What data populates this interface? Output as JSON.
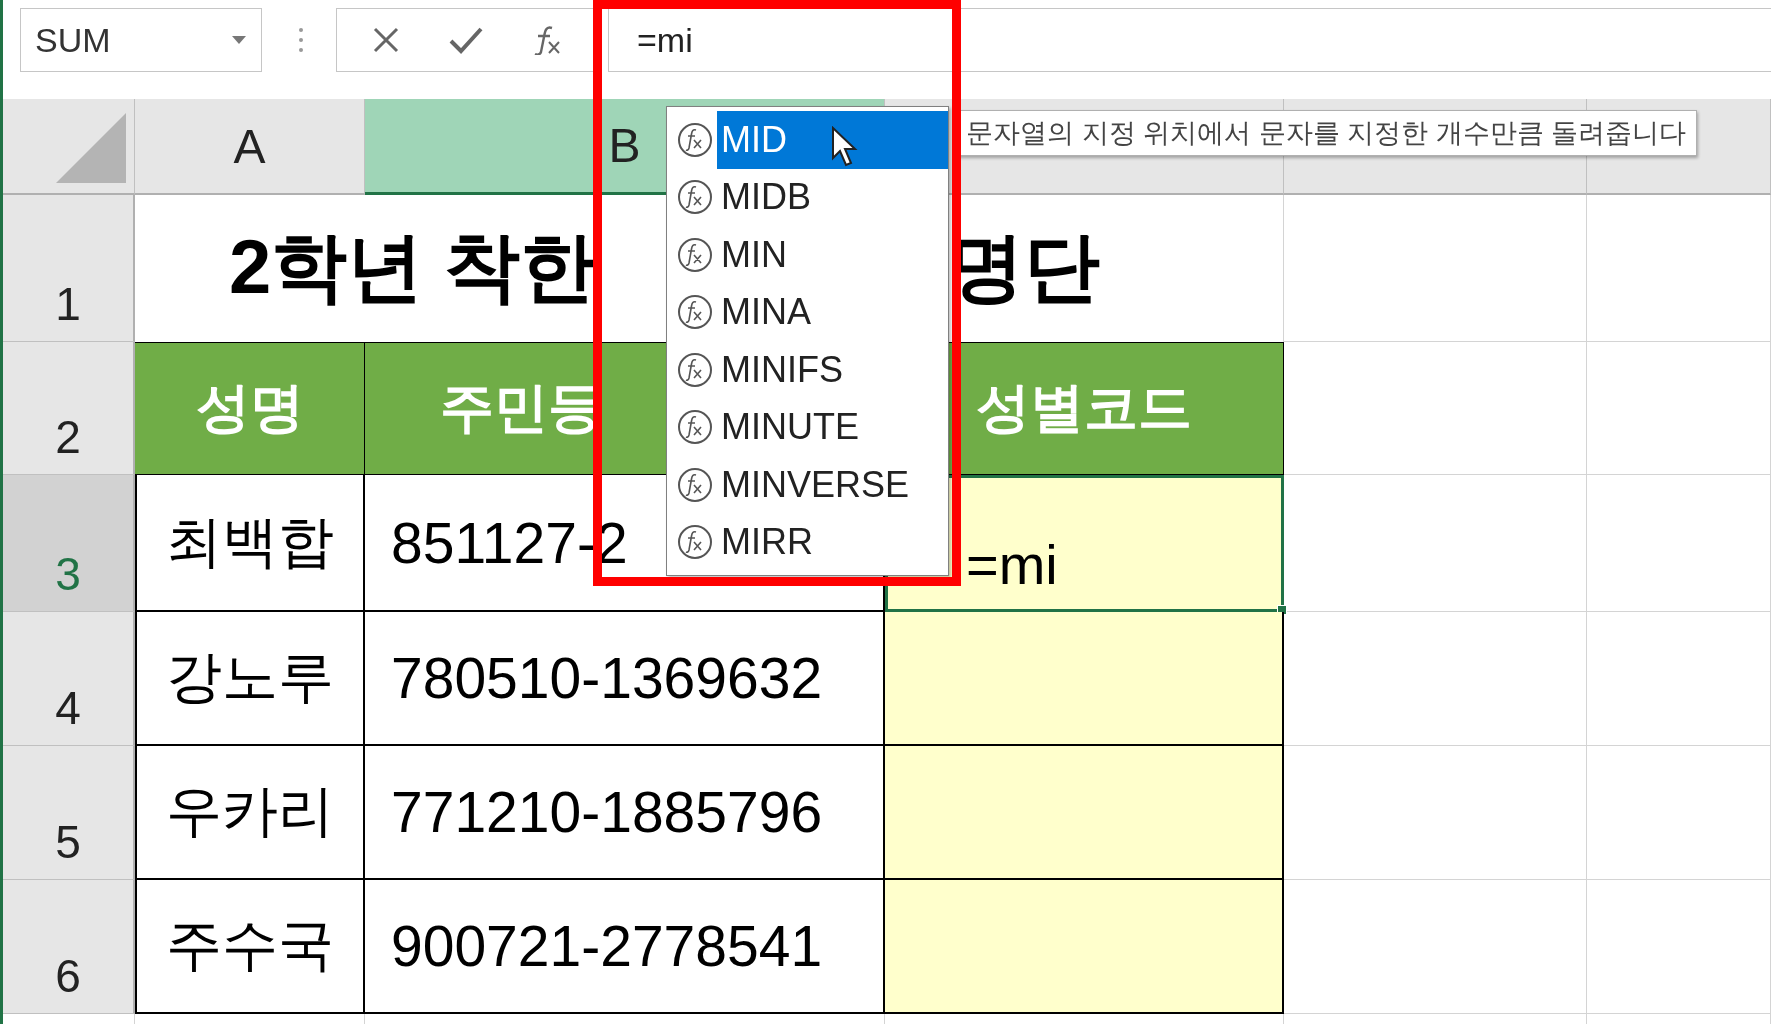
{
  "name_box": {
    "value": "SUM"
  },
  "formula_bar": {
    "value": "=mi"
  },
  "column_headers": [
    {
      "label": "A",
      "selected": false
    },
    {
      "label": "B",
      "selected": true
    }
  ],
  "rows": [
    {
      "number": "1",
      "selected": false,
      "kind": "title",
      "cells": [
        {
          "text": "2학년 착한"
        },
        {
          "text": "명단"
        }
      ]
    },
    {
      "number": "2",
      "selected": false,
      "kind": "header",
      "cells": [
        {
          "text": "성명"
        },
        {
          "text": "주민등"
        },
        {
          "text": "성별코드"
        }
      ]
    },
    {
      "number": "3",
      "selected": true,
      "kind": "data",
      "cells": [
        {
          "text": "최백합"
        },
        {
          "text": "851127-2"
        },
        {
          "text": "=mi",
          "active": true
        }
      ]
    },
    {
      "number": "4",
      "selected": false,
      "kind": "data",
      "cells": [
        {
          "text": "강노루"
        },
        {
          "text": "780510-1369632"
        },
        {
          "active": false
        }
      ]
    },
    {
      "number": "5",
      "selected": false,
      "kind": "data",
      "cells": [
        {
          "text": "우카리"
        },
        {
          "text": "771210-1885796"
        },
        {
          "active": false
        }
      ]
    },
    {
      "number": "6",
      "selected": false,
      "kind": "data",
      "cells": [
        {
          "text": "주수국"
        },
        {
          "text": "900721-2778541"
        },
        {
          "active": false
        }
      ]
    }
  ],
  "autocomplete": {
    "items": [
      {
        "label": "MID",
        "selected": true
      },
      {
        "label": "MIDB",
        "selected": false
      },
      {
        "label": "MIN",
        "selected": false
      },
      {
        "label": "MINA",
        "selected": false
      },
      {
        "label": "MINIFS",
        "selected": false
      },
      {
        "label": "MINUTE",
        "selected": false
      },
      {
        "label": "MINVERSE",
        "selected": false
      },
      {
        "label": "MIRR",
        "selected": false
      }
    ]
  },
  "tooltip": {
    "text": "문자열의 지정 위치에서 문자를 지정한 개수만큼 돌려줍니다"
  }
}
